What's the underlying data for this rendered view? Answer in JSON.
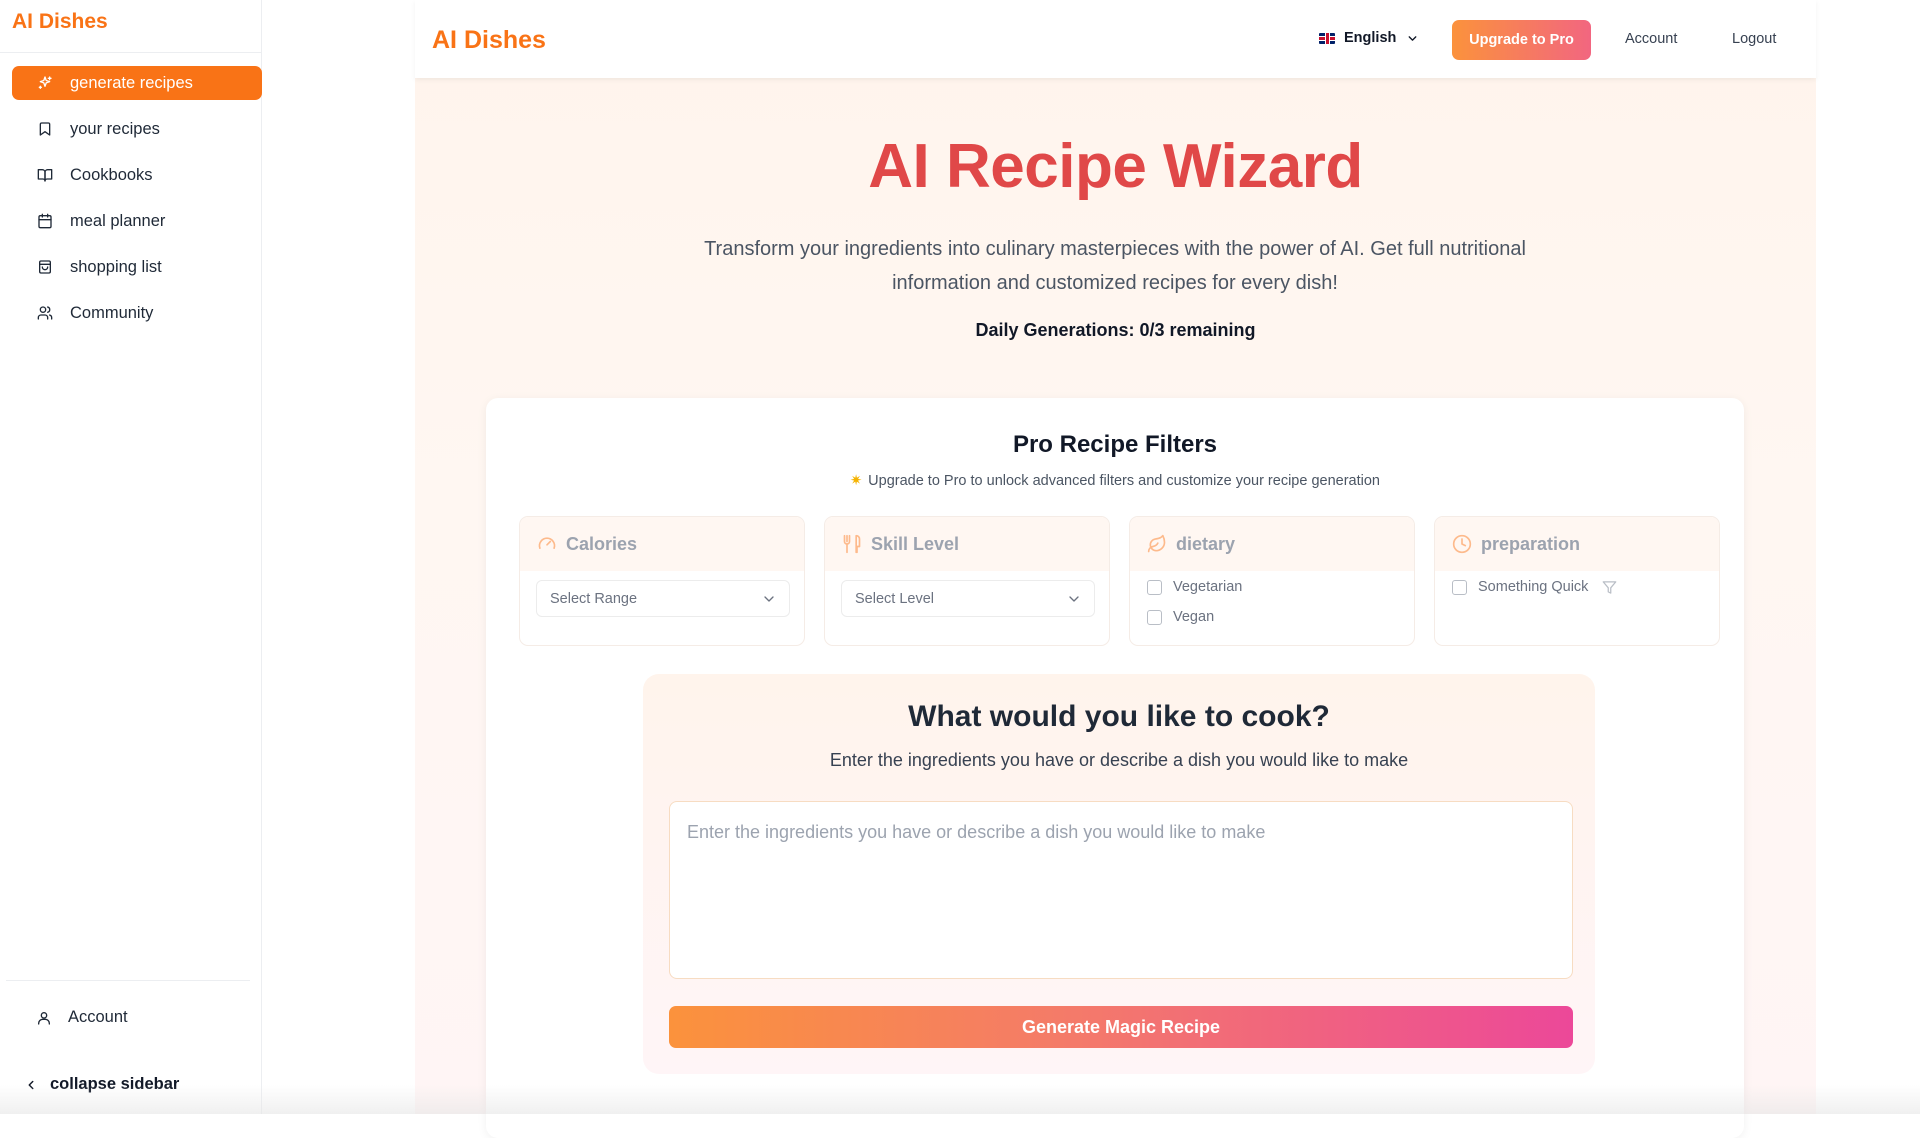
{
  "sidebar": {
    "brand": "AI Dishes",
    "items": [
      {
        "label": "generate recipes",
        "icon": "sparkles-icon",
        "active": true
      },
      {
        "label": "your recipes",
        "icon": "bookmark-icon"
      },
      {
        "label": "Cookbooks",
        "icon": "book-open-icon"
      },
      {
        "label": "meal planner",
        "icon": "calendar-icon"
      },
      {
        "label": "shopping list",
        "icon": "shopping-bag-icon"
      },
      {
        "label": "Community",
        "icon": "users-icon"
      }
    ],
    "account_label": "Account",
    "collapse_label": "collapse sidebar"
  },
  "topbar": {
    "brand": "AI Dishes",
    "language": "English",
    "upgrade_label": "Upgrade to Pro",
    "account_label": "Account",
    "logout_label": "Logout"
  },
  "hero": {
    "title": "AI Recipe Wizard",
    "subtitle": "Transform your ingredients into culinary masterpieces with the power of AI. Get full nutritional information and customized recipes for every dish!",
    "daily": "Daily Generations: 0/3 remaining"
  },
  "filters": {
    "title": "Pro Recipe Filters",
    "note": "Upgrade to Pro to unlock advanced filters and customize your recipe generation",
    "calories": {
      "label": "Calories",
      "select": "Select Range"
    },
    "skill": {
      "label": "Skill Level",
      "select": "Select Level"
    },
    "dietary": {
      "label": "dietary",
      "options": [
        "Vegetarian",
        "Vegan"
      ]
    },
    "preparation": {
      "label": "preparation",
      "options": [
        "Something Quick"
      ]
    }
  },
  "cook": {
    "title": "What would you like to cook?",
    "subtitle": "Enter the ingredients you have or describe a dish you would like to make",
    "placeholder": "Enter the ingredients you have or describe a dish you would like to make",
    "button": "Generate Magic Recipe"
  },
  "colors": {
    "accent": "#f97316",
    "title_red": "#e04848",
    "gradient_end": "#ec4899"
  }
}
